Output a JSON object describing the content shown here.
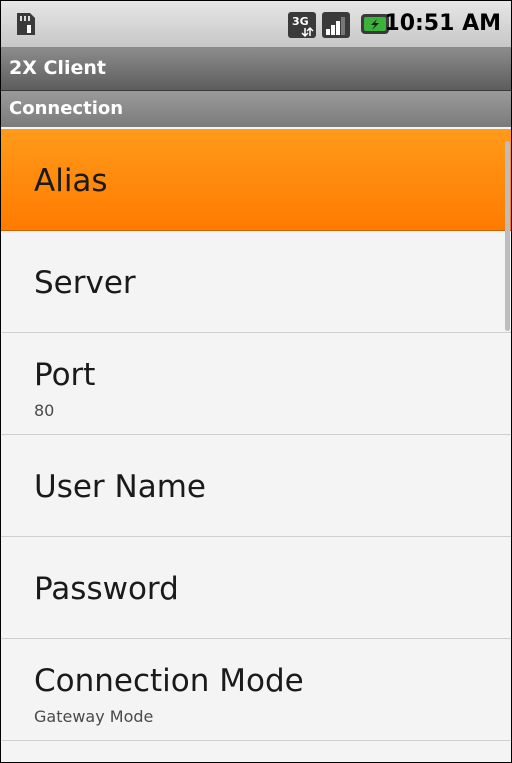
{
  "status_bar": {
    "time": "10:51 AM",
    "network_type": "3G",
    "icons": [
      "sd-card-icon",
      "3g-data-icon",
      "signal-strength-icon",
      "battery-charging-icon"
    ]
  },
  "app": {
    "title": "2X Client"
  },
  "section": {
    "label": "Connection"
  },
  "preferences": [
    {
      "title": "Alias",
      "summary": "",
      "selected": true
    },
    {
      "title": "Server",
      "summary": "",
      "selected": false
    },
    {
      "title": "Port",
      "summary": "80",
      "selected": false
    },
    {
      "title": "User Name",
      "summary": "",
      "selected": false
    },
    {
      "title": "Password",
      "summary": "",
      "selected": false
    },
    {
      "title": "Connection Mode",
      "summary": "Gateway Mode",
      "selected": false
    }
  ],
  "colors": {
    "selected_item": "#ff8a00",
    "title_bar": "#6e6e6e",
    "list_background": "#f4f4f4"
  }
}
